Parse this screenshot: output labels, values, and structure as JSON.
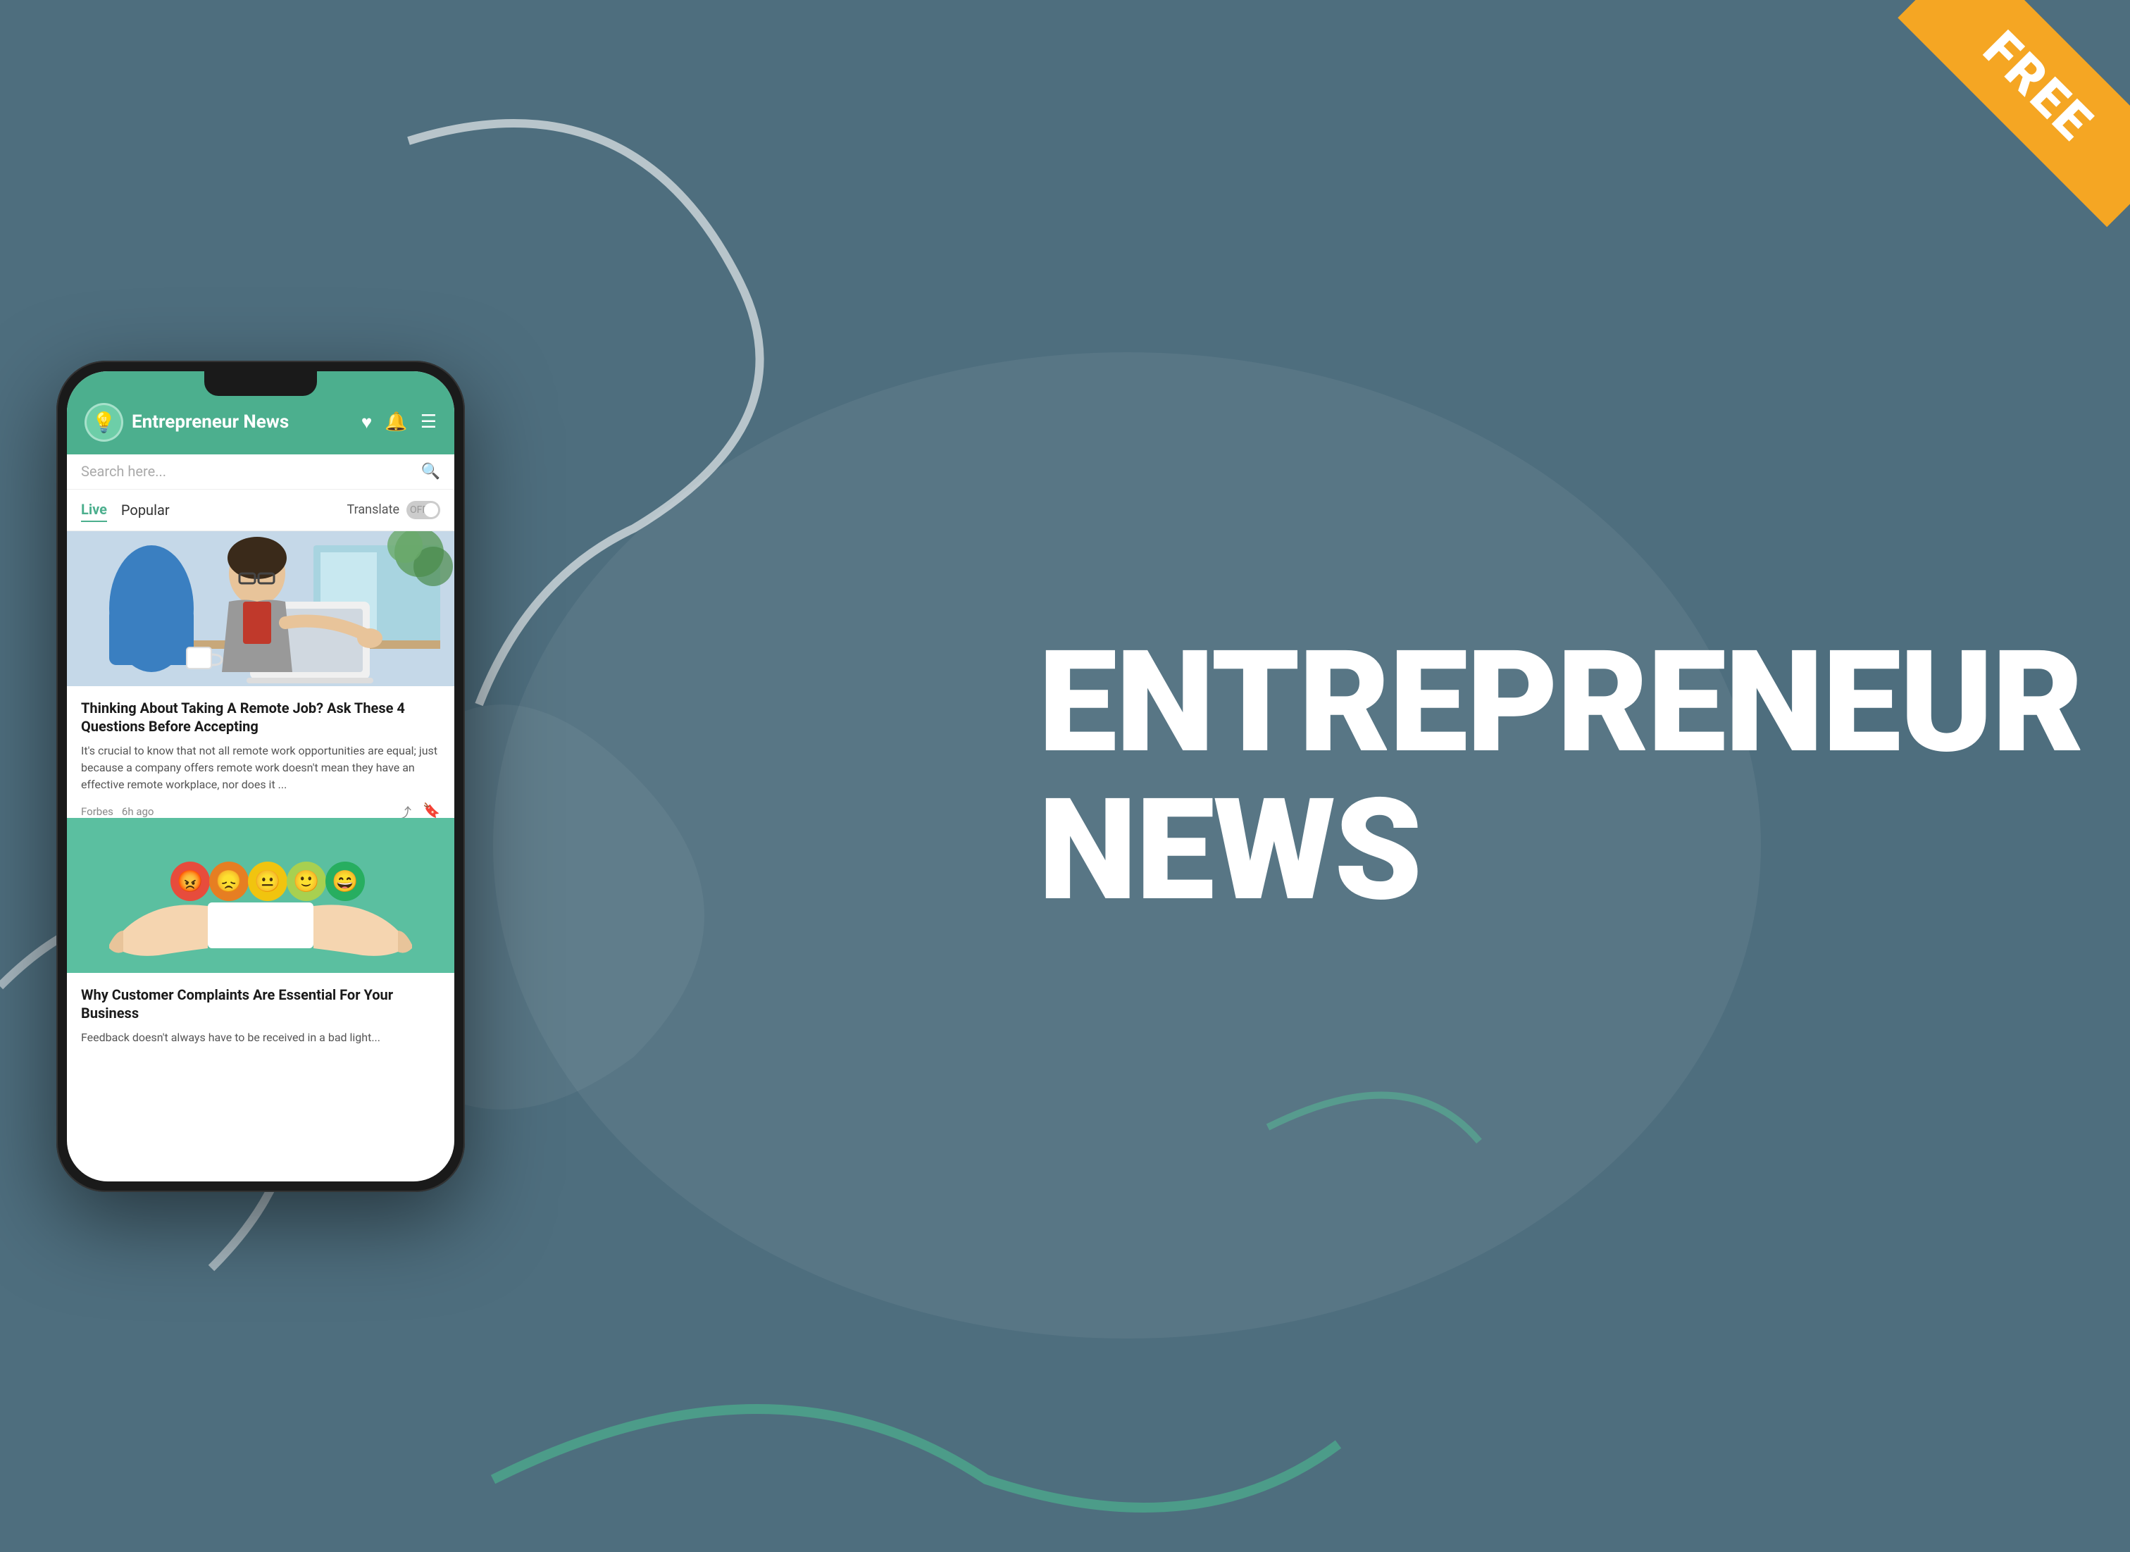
{
  "background": {
    "color": "#4e6e7e"
  },
  "free_badge": {
    "label": "FREE"
  },
  "brand": {
    "title_line1": "ENTREPRENEUR",
    "title_line2": "NEWS"
  },
  "app": {
    "header": {
      "logo_icon": "💡",
      "title": "Entrepreneur News",
      "heart_icon": "♥",
      "bell_icon": "🔔",
      "menu_icon": "☰"
    },
    "search": {
      "placeholder": "Search here..."
    },
    "filters": {
      "tabs": [
        {
          "label": "Live",
          "active": true
        },
        {
          "label": "Popular",
          "active": false
        }
      ],
      "translate_label": "Translate",
      "toggle_state": "OFF"
    },
    "articles": [
      {
        "id": 1,
        "title": "Thinking About Taking A Remote Job? Ask These 4 Questions Before Accepting",
        "excerpt": "It's crucial to know that not all remote work opportunities are equal; just because a company offers remote work doesn't mean they have an effective remote workplace, nor does it ...",
        "source": "Forbes",
        "time": "6h ago",
        "share_icon": "share",
        "bookmark_icon": "bookmark"
      },
      {
        "id": 2,
        "title": "Why Customer Complaints Are Essential For Your Business",
        "excerpt": "Feedback doesn't always have to be received in a bad light...",
        "source": "",
        "time": "",
        "bg_color": "#4caf8e",
        "emoji_faces": [
          "😡",
          "😞",
          "😐",
          "😊",
          "😄"
        ]
      }
    ]
  },
  "decorations": {
    "curves": "white lines decorative"
  }
}
